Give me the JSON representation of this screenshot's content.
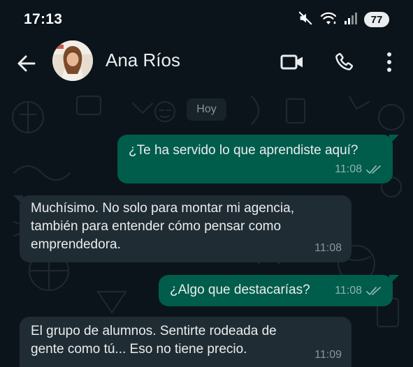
{
  "status_bar": {
    "time": "17:13",
    "battery": "77",
    "icons": [
      "mute-icon",
      "wifi-icon",
      "signal-icon"
    ]
  },
  "header": {
    "contact_name": "Ana Ríos",
    "back_icon": "arrow-left-icon",
    "actions": [
      "video-call-icon",
      "phone-icon",
      "more-vertical-icon"
    ]
  },
  "chat": {
    "day_label": "Hoy",
    "messages": [
      {
        "direction": "out",
        "text": "¿Te ha servido lo que aprendiste aquí?",
        "time": "11:08",
        "status": "read"
      },
      {
        "direction": "in",
        "text": "Muchísimo. No solo para montar mi agencia,\ntambién para entender cómo pensar como\nemprendedora.",
        "time": "11:08"
      },
      {
        "direction": "out",
        "text": "¿Algo que destacarías?",
        "time": "11:08",
        "status": "read"
      },
      {
        "direction": "in",
        "text": "El grupo de alumnos. Sentirte rodeada de\ngente como tú... Eso no tiene precio.",
        "time": "11:09"
      }
    ]
  },
  "colors": {
    "background": "#0b141a",
    "outgoing_bubble": "#005c4b",
    "incoming_bubble": "#202c33",
    "read_ticks": "#8fb3ad"
  }
}
